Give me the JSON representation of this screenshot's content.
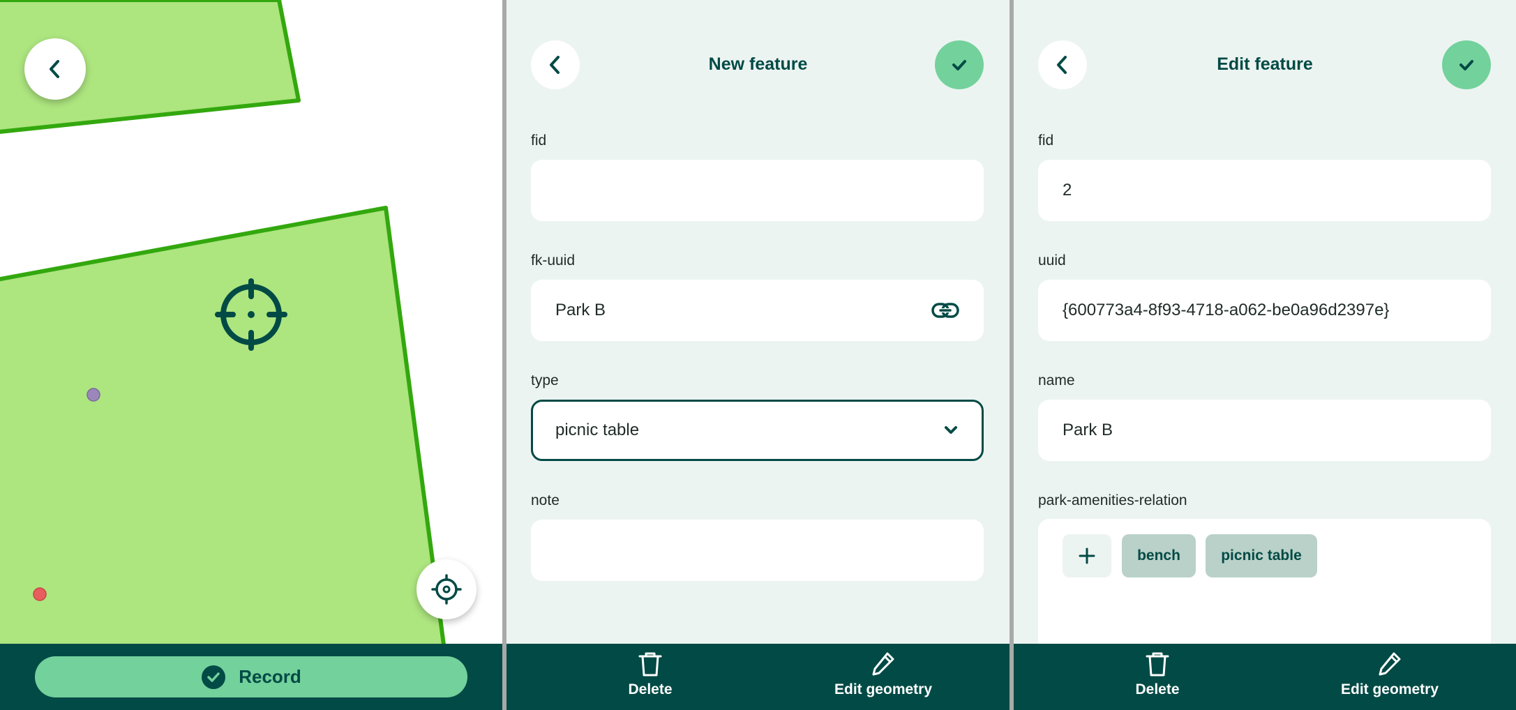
{
  "colors": {
    "primary": "#024a45",
    "accent": "#73d19c",
    "panel": "#ecf4f1",
    "polygon_fill": "#ade57f",
    "polygon_stroke": "#33a80e",
    "chip": "#b9d1c8",
    "point_purple": "#9b87b9",
    "point_red": "#e85d5d"
  },
  "map_screen": {
    "back_icon": "chevron-left-icon",
    "crosshair_icon": "crosshair-icon",
    "gps_icon": "gps-target-icon",
    "record_button": {
      "icon": "check-circle-icon",
      "label": "Record"
    }
  },
  "new_feature_form": {
    "title": "New feature",
    "fields": [
      {
        "label": "fid",
        "value": ""
      },
      {
        "label": "fk-uuid",
        "value": "Park B",
        "icon": "link-icon"
      },
      {
        "label": "type",
        "value": "picnic table",
        "icon": "chevron-down-icon"
      },
      {
        "label": "note",
        "value": ""
      }
    ],
    "actions": {
      "delete": "Delete",
      "edit_geometry": "Edit geometry"
    }
  },
  "edit_feature_form": {
    "title": "Edit feature",
    "fields": [
      {
        "label": "fid",
        "value": "2"
      },
      {
        "label": "uuid",
        "value": "{600773a4-8f93-4718-a062-be0a96d2397e}"
      },
      {
        "label": "name",
        "value": "Park B"
      }
    ],
    "relation": {
      "label": "park-amenities-relation",
      "add_icon": "plus-icon",
      "chips": [
        "bench",
        "picnic table"
      ]
    },
    "actions": {
      "delete": "Delete",
      "edit_geometry": "Edit geometry"
    }
  }
}
